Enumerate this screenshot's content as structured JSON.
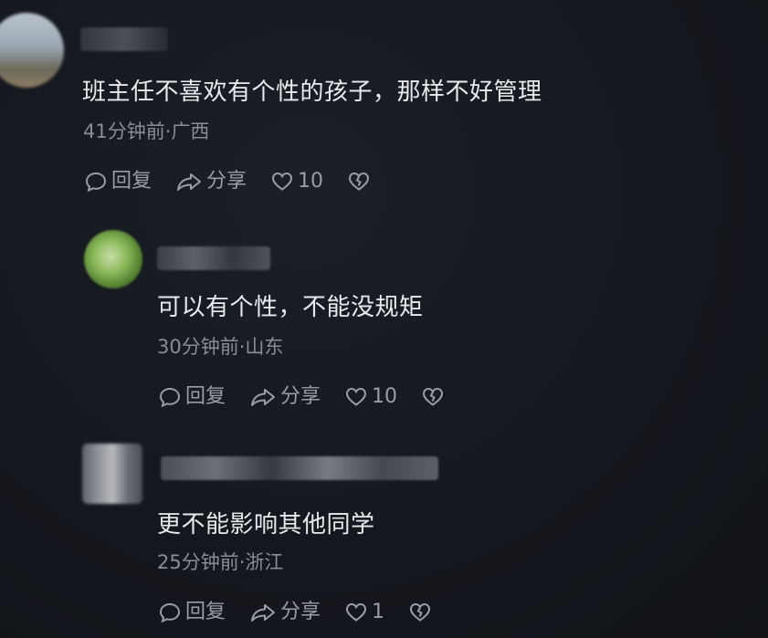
{
  "comments": [
    {
      "content": "班主任不喜欢有个性的孩子，那样不好管理",
      "time_location": "41分钟前·广西",
      "reply_label": "回复",
      "share_label": "分享",
      "like_count": "10"
    },
    {
      "content": "可以有个性，不能没规矩",
      "time_location": "30分钟前·山东",
      "reply_label": "回复",
      "share_label": "分享",
      "like_count": "10"
    },
    {
      "content": "更不能影响其他同学",
      "time_location": "25分钟前·浙江",
      "reply_label": "回复",
      "share_label": "分享",
      "like_count": "1"
    }
  ],
  "icons": {
    "reply": "speech-bubble-icon",
    "share": "share-arrow-icon",
    "like": "heart-icon",
    "dislike": "broken-heart-icon"
  },
  "colors": {
    "background": "#14171d",
    "text": "#e9eaec",
    "meta": "#8a8d94",
    "action": "#9a9da4"
  }
}
